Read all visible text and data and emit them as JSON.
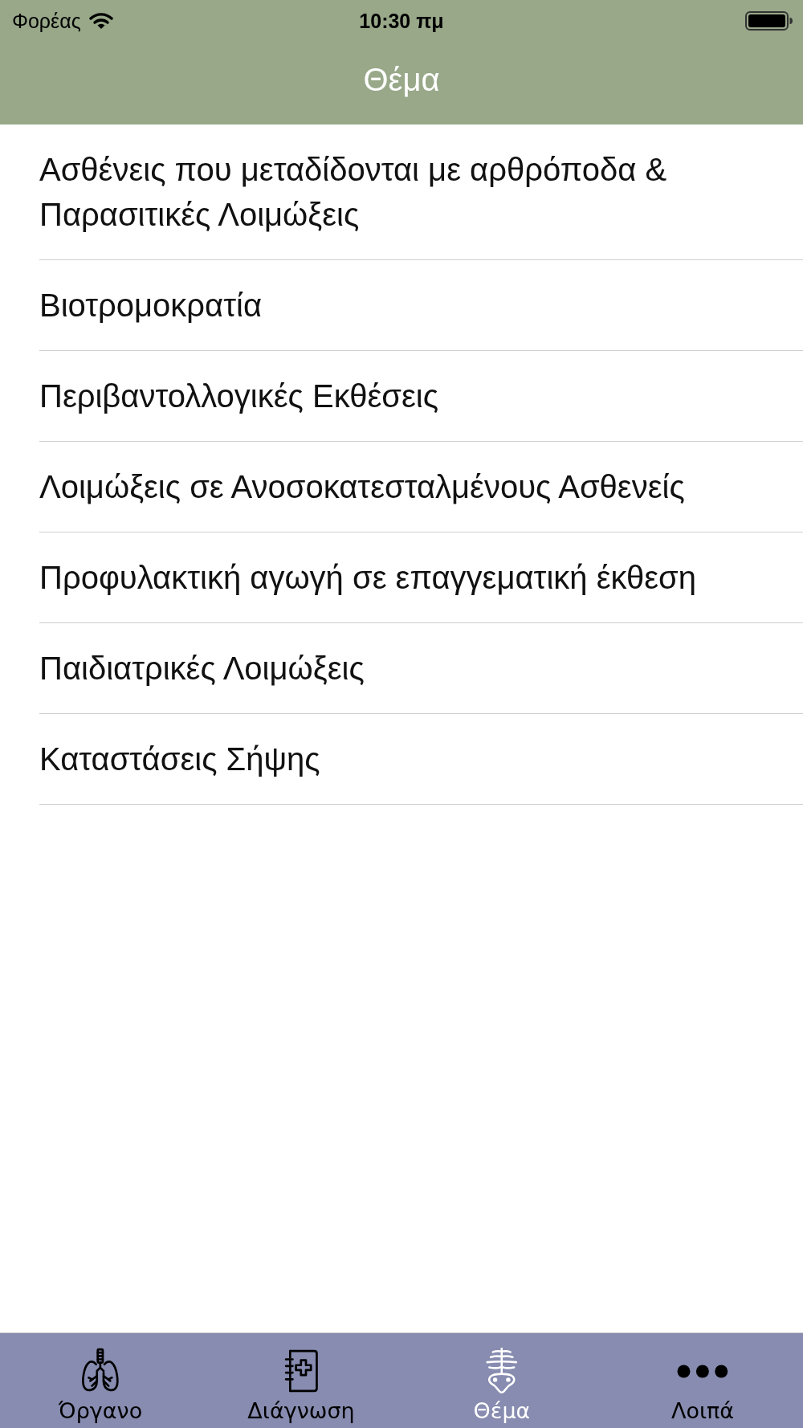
{
  "status_bar": {
    "carrier": "Φορέας",
    "time": "10:30 πμ"
  },
  "nav_bar": {
    "title": "Θέμα"
  },
  "list": {
    "items": [
      {
        "label": "Ασθένεις που μεταδίδονται με αρθρόποδα & Παρασιτικές Λοιμώξεις"
      },
      {
        "label": "Βιοτρομοκρατία"
      },
      {
        "label": "Περιβαντολλογικές Εκθέσεις"
      },
      {
        "label": "Λοιμώξεις σε Ανοσοκατεσταλμένους Ασθενείς"
      },
      {
        "label": "Προφυλακτική αγωγή σε επαγγεματική έκθεση"
      },
      {
        "label": "Παιδιατρικές Λοιμώξεις"
      },
      {
        "label": "Καταστάσεις Σήψης"
      }
    ]
  },
  "tab_bar": {
    "tabs": [
      {
        "label": "Όργανο",
        "selected": false
      },
      {
        "label": "Διάγνωση",
        "selected": false
      },
      {
        "label": "Θέμα",
        "selected": true
      },
      {
        "label": "Λοιπά",
        "selected": false
      }
    ]
  }
}
